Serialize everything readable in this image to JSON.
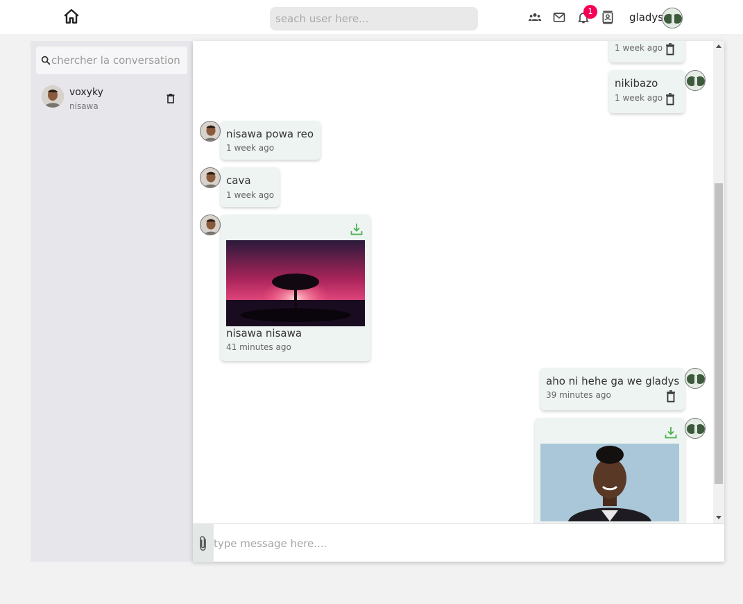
{
  "header": {
    "search_placeholder": "seach user here...",
    "notification_count": "1",
    "username": "gladys"
  },
  "sidebar": {
    "search_placeholder": "chercher la conversation",
    "conversations": [
      {
        "name": "voxyky",
        "subtitle": "nisawa"
      }
    ]
  },
  "messages": [
    {
      "sender": "gladys",
      "text": "",
      "time": "1 week ago",
      "deletable": true
    },
    {
      "sender": "gladys",
      "text": "nikibazo",
      "time": "1 week ago",
      "deletable": true
    },
    {
      "sender": "voxyky",
      "text": "nisawa powa reo",
      "time": "1 week ago"
    },
    {
      "sender": "voxyky",
      "text": "cava",
      "time": "1 week ago"
    },
    {
      "sender": "voxyky",
      "text": "nisawa nisawa",
      "time": "41 minutes ago",
      "attachment": "image",
      "downloadable": true
    },
    {
      "sender": "gladys",
      "text": "aho ni hehe ga we gladys",
      "time": "39 minutes ago",
      "deletable": true
    },
    {
      "sender": "gladys",
      "text": "",
      "time": "",
      "attachment": "image",
      "downloadable": true
    }
  ],
  "composer": {
    "placeholder": "type message here...."
  },
  "colors": {
    "badge": "#f50057",
    "download": "#4caf50",
    "bubble": "#eef4f2",
    "sidebar": "#e6e6eb"
  },
  "icons": {
    "home": "home-icon",
    "people": "people-icon",
    "mail": "mail-icon",
    "bell": "bell-icon",
    "contact": "contact-card-icon",
    "search": "search-icon",
    "trash": "trash-icon",
    "download": "download-icon",
    "attach": "paperclip-icon"
  }
}
